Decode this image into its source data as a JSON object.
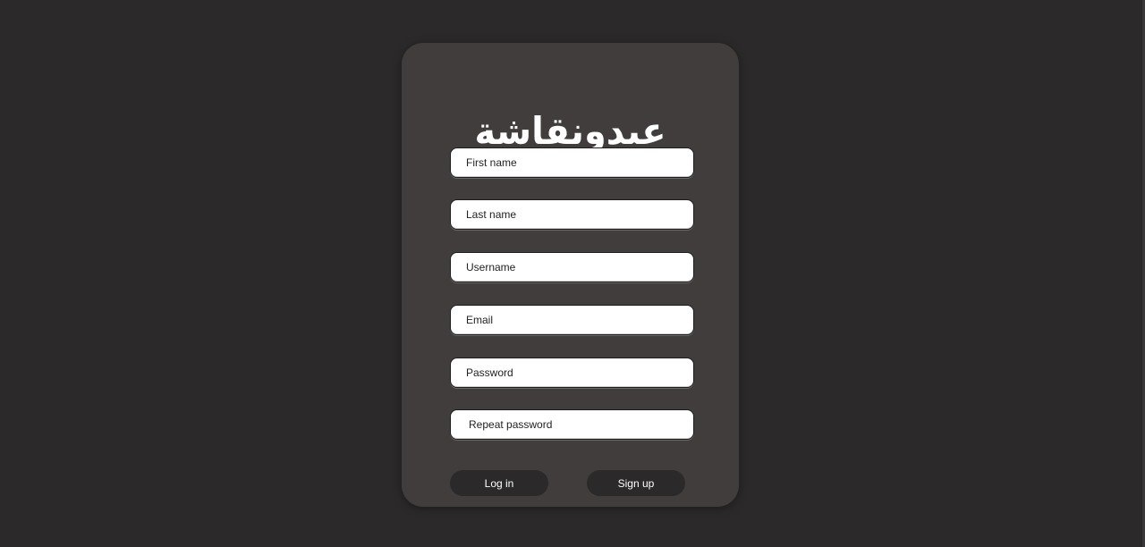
{
  "brand": {
    "logo_text": "عبدونقاشة"
  },
  "form": {
    "first_name": {
      "placeholder": "First name",
      "value": ""
    },
    "last_name": {
      "placeholder": "Last name",
      "value": ""
    },
    "username": {
      "placeholder": "Username",
      "value": ""
    },
    "email": {
      "placeholder": "Email",
      "value": ""
    },
    "password": {
      "placeholder": "Password",
      "value": ""
    },
    "repeat_password": {
      "placeholder": "Repeat password",
      "value": ""
    }
  },
  "actions": {
    "login_label": "Log in",
    "signup_label": "Sign up"
  },
  "colors": {
    "background": "#2b292a",
    "card": "#403d3c",
    "button": "#2b2929",
    "text_on_button": "#ffffff"
  }
}
